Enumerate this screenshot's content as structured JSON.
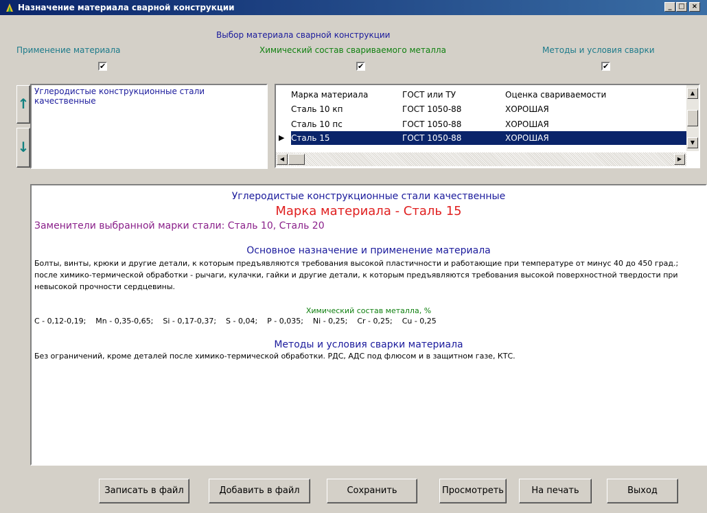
{
  "window": {
    "title": "Назначение материала сварной конструкции",
    "minimize": "_",
    "maximize": "□",
    "close": "×"
  },
  "header": {
    "selection_title": "Выбор материала сварной конструкции",
    "application_label": "Применение материала",
    "chemical_label": "Химический состав свариваемого металла",
    "methods_label": "Методы и условия сварки"
  },
  "checkboxes": {
    "application": "✔",
    "chemical": "✔",
    "methods": "✔"
  },
  "category": {
    "text": "Углеродистые конструкционные стали качественные",
    "up_arrow": "↑",
    "down_arrow": "↓"
  },
  "grid": {
    "columns": [
      "Марка материала",
      "ГОСТ или ТУ",
      "Оценка свариваемости"
    ],
    "rows": [
      [
        "Сталь 10 кп",
        "ГОСТ 1050-88",
        "ХОРОШАЯ"
      ],
      [
        "Сталь 10 пс",
        "ГОСТ 1050-88",
        "ХОРОШАЯ"
      ],
      [
        "Сталь 15",
        "ГОСТ 1050-88",
        "ХОРОШАЯ"
      ]
    ],
    "selected_marker": "▶"
  },
  "memo": {
    "category_heading": "Углеродистые конструкционные стали качественные",
    "grade_heading": "Марка материала - Сталь 15",
    "substitutes": "Заменители выбранной марки стали: Сталь 10, Сталь 20",
    "purpose_heading": "Основное назначение и применение материала",
    "purpose_text": "Болты, винты, крюки и другие детали, к которым предъявляются требования высокой пластичности и   работающие при температуре  от минус 40 до 450 град.; после химико-термической обработки - рычаги, кулачки, гайки и другие детали, к которым предъявляются требования высокой поверхностной твердости   при невысокой прочности сердцевины.",
    "chemical_heading": "Химический состав металла, %",
    "chemical_text": "C - 0,12-0,19;    Mn - 0,35-0,65;    Si - 0,17-0,37;    S - 0,04;    P - 0,035;    Ni - 0,25;    Cr - 0,25;    Cu - 0,25",
    "methods_heading": "Методы и условия сварки материала",
    "methods_text": "Без ограничений, кроме деталей после химико-термической обработки. РДС, АДС под флюсом и в защитном газе, КТС."
  },
  "buttons": {
    "write_file": "Записать в файл",
    "append_file": "Добавить в файл",
    "save": "Сохранить",
    "view": "Просмотреть",
    "print": "На печать",
    "exit": "Выход"
  },
  "colors": {
    "title_bar": "#0a246a",
    "selection_highlight": "#0a246a",
    "heading_blue": "#1a1a9c",
    "grade_red": "#e02020",
    "substitutes_purple": "#8a208a",
    "chemical_green": "#108010"
  }
}
